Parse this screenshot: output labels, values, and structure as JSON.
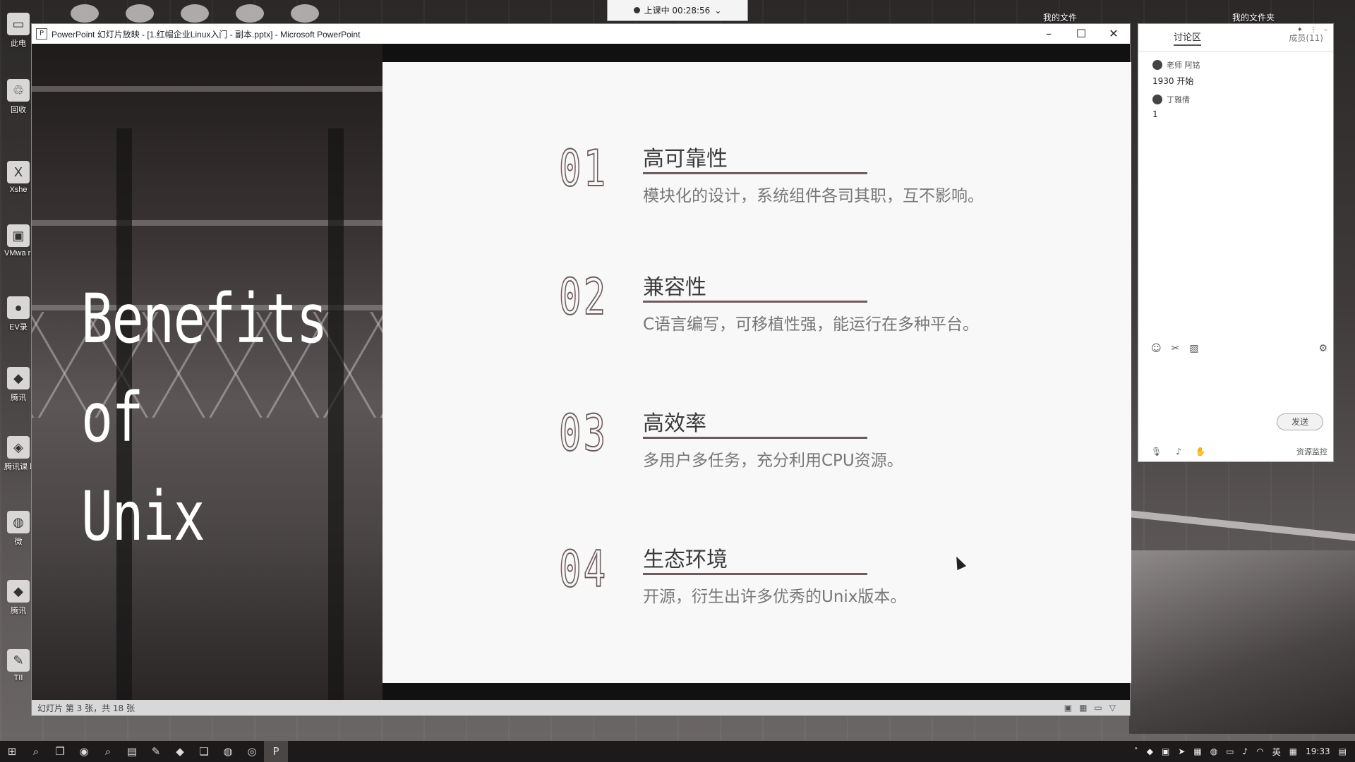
{
  "top_bar": {
    "class_status": "上课中 00:28:56",
    "folder_left": "我的文件",
    "folder_right": "我的文件夹"
  },
  "desktop_icons": [
    {
      "label": "此电",
      "icon": "computer-icon"
    },
    {
      "label": "回收",
      "icon": "recycle-bin-icon"
    },
    {
      "label": "Xshe",
      "icon": "xshell-icon"
    },
    {
      "label": "VMwa rkstatic",
      "icon": "vmware-icon"
    },
    {
      "label": "EV录",
      "icon": "ev-recorder-icon"
    },
    {
      "label": "腾讯",
      "icon": "tencent-icon"
    },
    {
      "label": "腾讯课 助",
      "icon": "tencent-class-icon"
    },
    {
      "label": "微",
      "icon": "wechat-icon"
    },
    {
      "label": "腾讯",
      "icon": "tencent-icon"
    },
    {
      "label": "TII",
      "icon": "app-icon"
    }
  ],
  "ppt": {
    "window_title": "PowerPoint 幻灯片放映 - [1.红帽企业Linux入门 - 副本.pptx] - Microsoft PowerPoint",
    "status_left": "幻灯片 第 3 张，共 18 张"
  },
  "slide": {
    "title_lines": [
      "Benefits",
      "of",
      "Unix"
    ],
    "items": [
      {
        "num": "01",
        "heading": "高可靠性",
        "desc": "模块化的设计，系统组件各司其职，互不影响。"
      },
      {
        "num": "02",
        "heading": "兼容性",
        "desc": "C语言编写，可移植性强，能运行在多种平台。"
      },
      {
        "num": "03",
        "heading": "高效率",
        "desc": "多用户多任务，充分利用CPU资源。"
      },
      {
        "num": "04",
        "heading": "生态环境",
        "desc": "开源，衍生出许多优秀的Unix版本。"
      }
    ]
  },
  "chat": {
    "tab": "讨论区",
    "count": "成员(11)",
    "messages": [
      {
        "author": "老师 阿铭",
        "text": "1930 开始"
      },
      {
        "author": "丁雅倩",
        "text": "1"
      }
    ],
    "send_label": "发送",
    "resource_label": "资源监控"
  },
  "taskbar": {
    "time": "19:33",
    "ime": "英"
  },
  "colors": {
    "accent": "#6e5c5c",
    "slide_bg": "#f8f8f8"
  }
}
